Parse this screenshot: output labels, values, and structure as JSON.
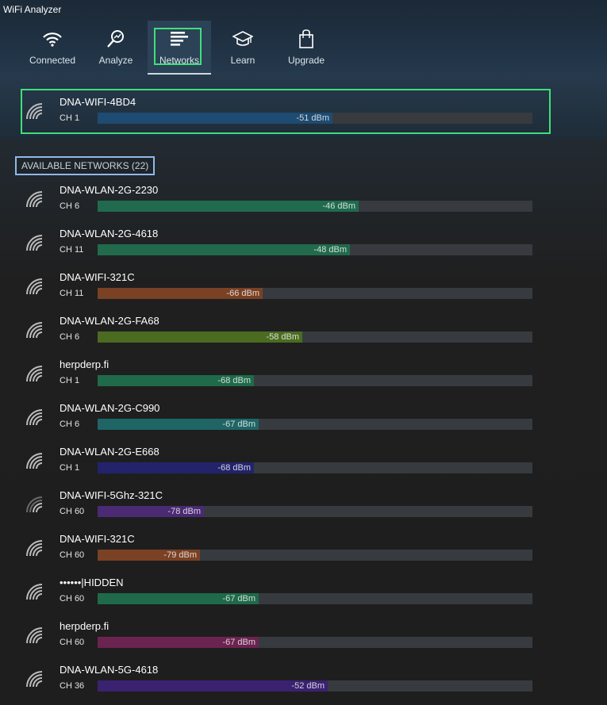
{
  "app": {
    "title": "WiFi Analyzer"
  },
  "nav": [
    {
      "label": "Connected",
      "icon": "wifi-icon"
    },
    {
      "label": "Analyze",
      "icon": "magnifier-icon"
    },
    {
      "label": "Networks",
      "icon": "networks-icon",
      "active": true
    },
    {
      "label": "Learn",
      "icon": "graduation-cap-icon"
    },
    {
      "label": "Upgrade",
      "icon": "shopping-bag-icon"
    }
  ],
  "connected_network": {
    "ssid": "DNA-WIFI-4BD4",
    "channel": "CH 1",
    "signal": "-51 dBm",
    "level": 0.54,
    "color": "#1e4b71"
  },
  "available": {
    "header": "AVAILABLE NETWORKS (22)",
    "networks": [
      {
        "ssid": "DNA-WLAN-2G-2230",
        "channel": "CH 6",
        "signal": "-46 dBm",
        "level": 0.6,
        "color": "#206b4e"
      },
      {
        "ssid": "DNA-WLAN-2G-4618",
        "channel": "CH 11",
        "signal": "-48 dBm",
        "level": 0.58,
        "color": "#226a4c"
      },
      {
        "ssid": "DNA-WIFI-321C",
        "channel": "CH 11",
        "signal": "-66 dBm",
        "level": 0.38,
        "color": "#7a4124"
      },
      {
        "ssid": "DNA-WLAN-2G-FA68",
        "channel": "CH 6",
        "signal": "-58 dBm",
        "level": 0.47,
        "color": "#4b6b21"
      },
      {
        "ssid": "herpderp.fi",
        "channel": "CH 1",
        "signal": "-68 dBm",
        "level": 0.36,
        "color": "#1f6a4a"
      },
      {
        "ssid": "DNA-WLAN-2G-C990",
        "channel": "CH 6",
        "signal": "-67 dBm",
        "level": 0.37,
        "color": "#1f6566"
      },
      {
        "ssid": "DNA-WLAN-2G-E668",
        "channel": "CH 1",
        "signal": "-68 dBm",
        "level": 0.36,
        "color": "#23236c"
      },
      {
        "ssid": "DNA-WIFI-5Ghz-321C",
        "channel": "CH 60",
        "signal": "-78 dBm",
        "level": 0.245,
        "color": "#4a2a72",
        "weak": true
      },
      {
        "ssid": "DNA-WIFI-321C",
        "channel": "CH 60",
        "signal": "-79 dBm",
        "level": 0.235,
        "color": "#7a4124"
      },
      {
        "ssid": "••••••|HIDDEN",
        "channel": "CH 60",
        "signal": "-67 dBm",
        "level": 0.37,
        "color": "#1f6a4a"
      },
      {
        "ssid": "herpderp.fi",
        "channel": "CH 60",
        "signal": "-67 dBm",
        "level": 0.37,
        "color": "#6b2350"
      },
      {
        "ssid": "DNA-WLAN-5G-4618",
        "channel": "CH 36",
        "signal": "-52 dBm",
        "level": 0.53,
        "color": "#3a2270"
      }
    ]
  }
}
